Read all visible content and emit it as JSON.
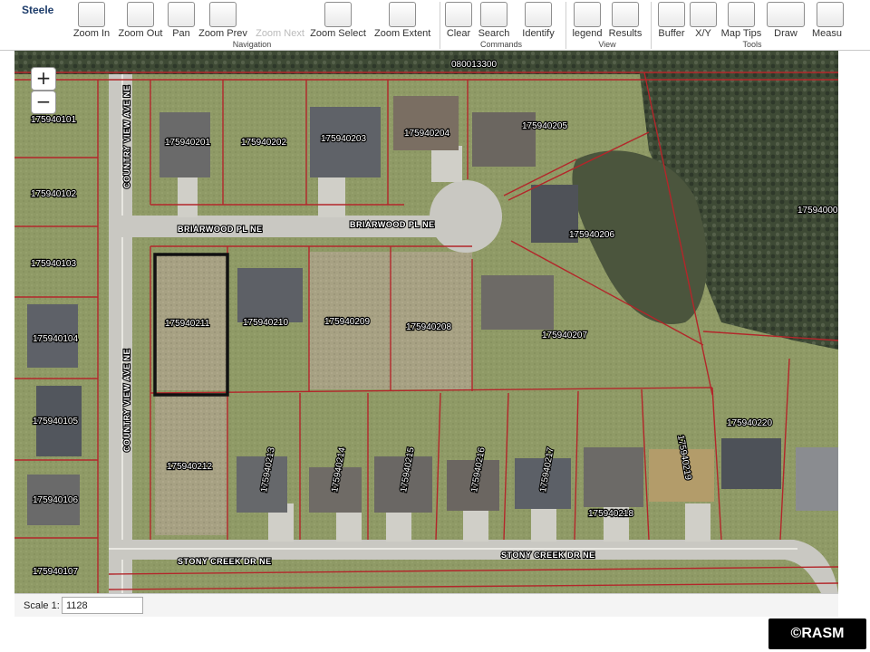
{
  "county": "Steele",
  "toolbar": {
    "navigation": {
      "group_label": "Navigation",
      "buttons": [
        {
          "label": "Zoom In"
        },
        {
          "label": "Zoom Out"
        },
        {
          "label": "Pan"
        },
        {
          "label": "Zoom Prev"
        },
        {
          "label": "Zoom Next",
          "disabled": true
        },
        {
          "label": "Zoom Select"
        },
        {
          "label": "Zoom Extent"
        }
      ]
    },
    "commands": {
      "group_label": "Commands",
      "buttons": [
        {
          "label": "Clear"
        },
        {
          "label": "Search"
        },
        {
          "label": "Identify"
        }
      ]
    },
    "view": {
      "group_label": "View",
      "buttons": [
        {
          "label": "legend"
        },
        {
          "label": "Results"
        }
      ]
    },
    "tools": {
      "group_label": "Tools",
      "buttons": [
        {
          "label": "Buffer"
        },
        {
          "label": "X/Y"
        },
        {
          "label": "Map Tips"
        },
        {
          "label": "Draw"
        },
        {
          "label": "Measu"
        }
      ]
    }
  },
  "map": {
    "zoom_in": "+",
    "zoom_out": "−",
    "parcels": [
      "080013300",
      "175940201",
      "175940202",
      "175940203",
      "175940204",
      "175940205",
      "175940101",
      "175940102",
      "175940103",
      "175940104",
      "175940105",
      "175940106",
      "175940107",
      "175940206",
      "175940207",
      "175940208",
      "175940209",
      "175940210",
      "175940211",
      "175940212",
      "175940213",
      "175940214",
      "175940215",
      "175940216",
      "175940217",
      "175940218",
      "175940219",
      "175940220",
      "17594000"
    ],
    "streets": [
      "BRIARWOOD PL NE",
      "BRIARWOOD PL NE",
      "COUNTRY VIEW AVE NE",
      "COUNTRY VIEW AVE NE",
      "STONY CREEK DR NE",
      "STONY CREEK DR NE"
    ],
    "colors": {
      "parcel_line": "#b3262a",
      "selected_parcel": "#111111",
      "grass": "#8c9a63",
      "trees": "#3f4a35",
      "road": "#c9c8c2"
    }
  },
  "status": {
    "scale_label": "Scale 1:",
    "scale_value": "1128"
  },
  "watermark": "©RASM"
}
